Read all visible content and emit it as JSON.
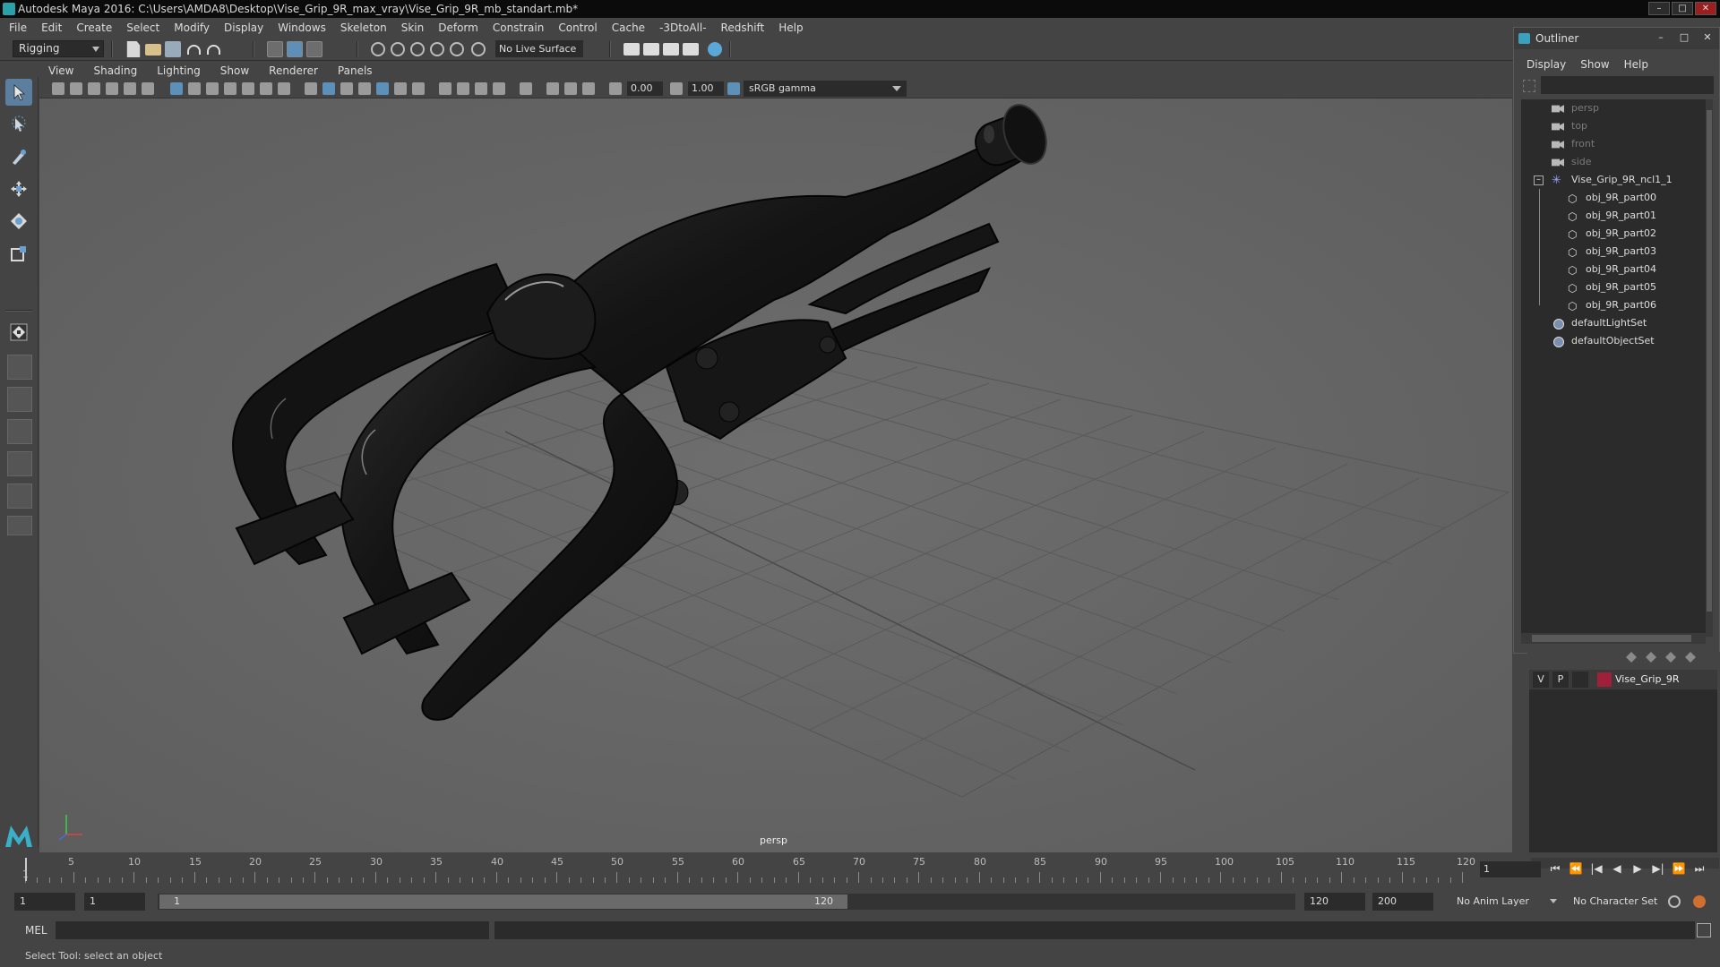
{
  "window": {
    "title": "Autodesk Maya 2016: C:\\Users\\AMDA8\\Desktop\\Vise_Grip_9R_max_vray\\Vise_Grip_9R_mb_standart.mb*",
    "controls": [
      "–",
      "□",
      "✕"
    ]
  },
  "menubar": [
    "File",
    "Edit",
    "Create",
    "Select",
    "Modify",
    "Display",
    "Windows",
    "Skeleton",
    "Skin",
    "Deform",
    "Constrain",
    "Control",
    "Cache",
    "-3DtoAll-",
    "Redshift",
    "Help"
  ],
  "statusline": {
    "mode": "Rigging",
    "live_surface": "No Live Surface"
  },
  "viewport": {
    "menu": [
      "View",
      "Shading",
      "Lighting",
      "Show",
      "Renderer",
      "Panels"
    ],
    "exposure": "0.00",
    "gamma": "1.00",
    "color_space": "sRGB gamma",
    "camera_label": "persp"
  },
  "outliner": {
    "title": "Outliner",
    "controls": [
      "–",
      "□",
      "✕"
    ],
    "menu": [
      "Display",
      "Show",
      "Help"
    ],
    "items": [
      {
        "label": "persp",
        "icon": "camera-icon",
        "dim": true
      },
      {
        "label": "top",
        "icon": "camera-icon",
        "dim": true
      },
      {
        "label": "front",
        "icon": "camera-icon",
        "dim": true
      },
      {
        "label": "side",
        "icon": "camera-icon",
        "dim": true
      },
      {
        "label": "Vise_Grip_9R_ncl1_1",
        "icon": "group-icon",
        "expanded": true
      },
      {
        "label": "obj_9R_part00",
        "icon": "mesh-icon"
      },
      {
        "label": "obj_9R_part01",
        "icon": "mesh-icon"
      },
      {
        "label": "obj_9R_part02",
        "icon": "mesh-icon"
      },
      {
        "label": "obj_9R_part03",
        "icon": "mesh-icon"
      },
      {
        "label": "obj_9R_part04",
        "icon": "mesh-icon"
      },
      {
        "label": "obj_9R_part05",
        "icon": "mesh-icon"
      },
      {
        "label": "obj_9R_part06",
        "icon": "mesh-icon"
      },
      {
        "label": "defaultLightSet",
        "icon": "set-icon"
      },
      {
        "label": "defaultObjectSet",
        "icon": "set-icon"
      }
    ]
  },
  "layers": {
    "rows": [
      {
        "v": "V",
        "p": "P",
        "name": "Vise_Grip_9R",
        "color": "#a0203a"
      }
    ]
  },
  "timeline": {
    "ticks": [
      "5",
      "10",
      "15",
      "20",
      "25",
      "30",
      "35",
      "40",
      "45",
      "50",
      "55",
      "60",
      "65",
      "70",
      "75",
      "80",
      "85",
      "90",
      "95",
      "100",
      "105",
      "110",
      "115",
      "120"
    ],
    "current_label": "1",
    "current_frame": "1",
    "playback_buttons": [
      "⏮",
      "⏪",
      "|◀",
      "◀",
      "▶",
      "▶|",
      "⏩",
      "⏭"
    ]
  },
  "range": {
    "start": "1",
    "playback_start": "1",
    "slider_low": "1",
    "slider_high": "120",
    "playback_end": "120",
    "end": "200",
    "anim_layer": "No Anim Layer",
    "character_set": "No Character Set"
  },
  "command": {
    "language": "MEL"
  },
  "help_line": "Select Tool: select an object",
  "colors": {
    "ui_bg": "#444444",
    "viewport_bg": "#686868",
    "field_bg": "#2b2b2b",
    "accent": "#5c90b8",
    "layer_color": "#a0203a"
  }
}
